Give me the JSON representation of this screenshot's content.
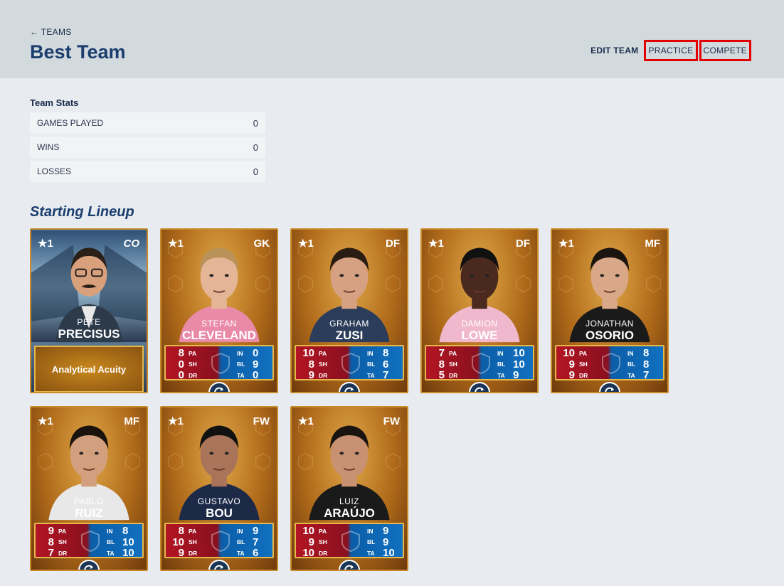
{
  "header": {
    "back_label": "← TEAMS",
    "title": "Best Team",
    "edit_label": "EDIT TEAM",
    "practice_label": "PRACTICE",
    "compete_label": "COMPETE",
    "highlight_color": "#e30000"
  },
  "team_stats": {
    "title": "Team Stats",
    "rows": [
      {
        "label": "GAMES PLAYED",
        "value": "0"
      },
      {
        "label": "WINS",
        "value": "0"
      },
      {
        "label": "LOSSES",
        "value": "0"
      }
    ]
  },
  "lineup": {
    "title": "Starting Lineup",
    "coach": {
      "rating": "★1",
      "position": "CO",
      "first": "PETE",
      "last": "PRECISUS",
      "ability": "Analytical Acuity"
    },
    "players": [
      {
        "rating": "★1",
        "position": "GK",
        "first": "STEFAN",
        "last": "CLEVELAND",
        "pa": "8",
        "sh": "0",
        "dr": "0",
        "in": "0",
        "bl": "9",
        "ta": "0"
      },
      {
        "rating": "★1",
        "position": "DF",
        "first": "GRAHAM",
        "last": "ZUSI",
        "pa": "10",
        "sh": "8",
        "dr": "9",
        "in": "8",
        "bl": "6",
        "ta": "7"
      },
      {
        "rating": "★1",
        "position": "DF",
        "first": "DAMION",
        "last": "LOWE",
        "pa": "7",
        "sh": "8",
        "dr": "5",
        "in": "10",
        "bl": "10",
        "ta": "9"
      },
      {
        "rating": "★1",
        "position": "MF",
        "first": "JONATHAN",
        "last": "OSORIO",
        "pa": "10",
        "sh": "9",
        "dr": "9",
        "in": "8",
        "bl": "8",
        "ta": "7"
      },
      {
        "rating": "★1",
        "position": "MF",
        "first": "PABLO",
        "last": "RUIZ",
        "pa": "9",
        "sh": "8",
        "dr": "7",
        "in": "8",
        "bl": "10",
        "ta": "10"
      },
      {
        "rating": "★1",
        "position": "FW",
        "first": "GUSTAVO",
        "last": "BOU",
        "pa": "8",
        "sh": "10",
        "dr": "9",
        "in": "9",
        "bl": "7",
        "ta": "6"
      },
      {
        "rating": "★1",
        "position": "FW",
        "first": "LUIZ",
        "last": "ARAÚJO",
        "pa": "10",
        "sh": "9",
        "dr": "10",
        "in": "9",
        "bl": "9",
        "ta": "10"
      }
    ],
    "stat_labels": {
      "pa": "PA",
      "sh": "SH",
      "dr": "DR",
      "in": "IN",
      "bl": "BL",
      "ta": "TA"
    }
  }
}
